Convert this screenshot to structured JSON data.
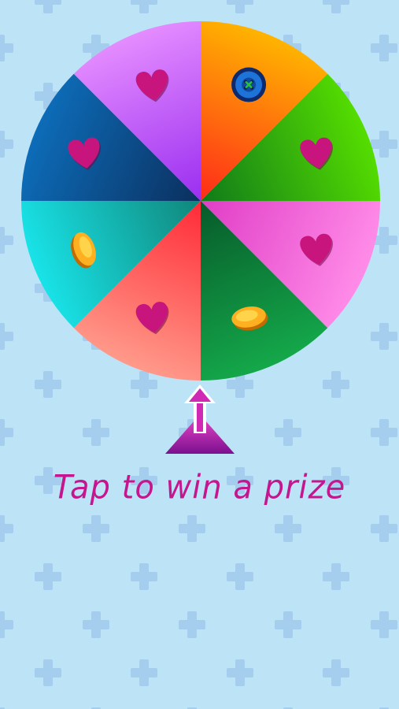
{
  "background": {
    "color": "#bde3f7",
    "pattern_icon": "plus-icon",
    "pattern_color": "#a4cdee"
  },
  "wheel": {
    "segments": [
      {
        "name": "orange",
        "color_light": "#ffb400",
        "color_dark": "#ff2a1a",
        "prize_icon": "button-icon"
      },
      {
        "name": "green",
        "color_light": "#55dd00",
        "color_dark": "#0f7a1a",
        "prize_icon": "heart-icon"
      },
      {
        "name": "pink",
        "color_light": "#ff8ce8",
        "color_dark": "#e03dc6",
        "prize_icon": "heart-icon"
      },
      {
        "name": "dark-green",
        "color_light": "#14a84a",
        "color_dark": "#075a2a",
        "prize_icon": "coin-icon"
      },
      {
        "name": "coral",
        "color_light": "#ff9a8a",
        "color_dark": "#ff2a36",
        "prize_icon": "heart-icon"
      },
      {
        "name": "teal",
        "color_light": "#19e3e8",
        "color_dark": "#10867a",
        "prize_icon": "coin-icon"
      },
      {
        "name": "navy",
        "color_light": "#0d6cb8",
        "color_dark": "#0b2f5e",
        "prize_icon": "heart-icon"
      },
      {
        "name": "purple",
        "color_light": "#e48cff",
        "color_dark": "#9a2ef0",
        "prize_icon": "heart-icon"
      }
    ]
  },
  "pointer": {
    "icon": "up-arrow-icon",
    "color_top": "#f049c8",
    "color_bottom": "#7a108f"
  },
  "prompt": {
    "text": "Tap to win a prize",
    "color": "#c4168e"
  }
}
